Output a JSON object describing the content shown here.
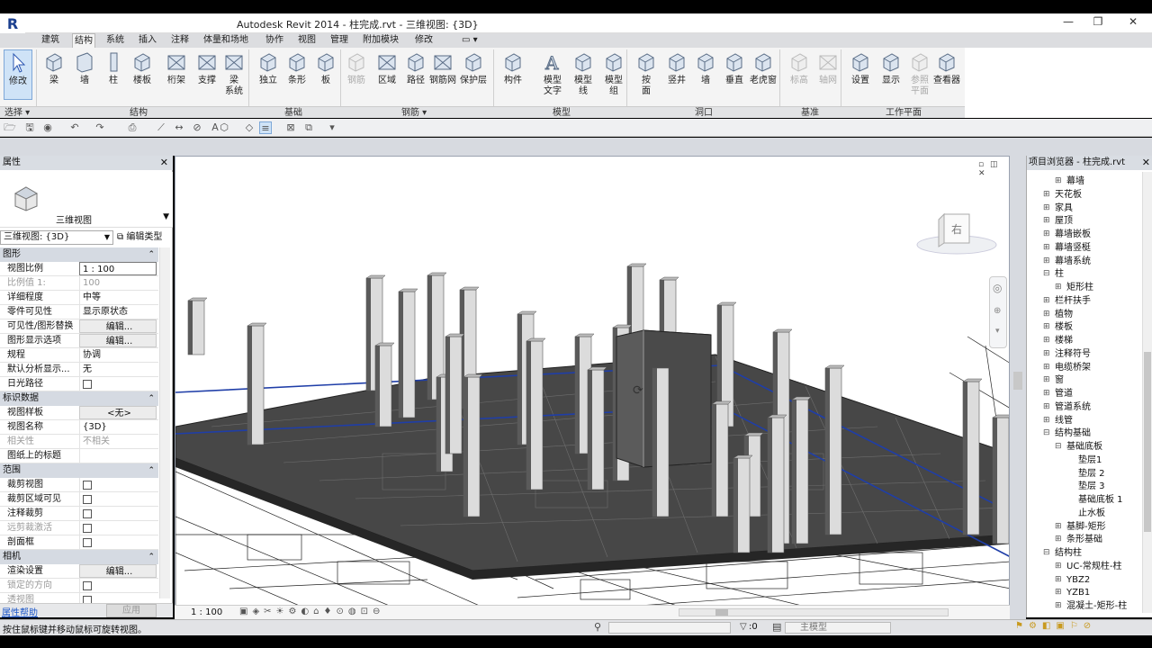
{
  "app": {
    "title": "Autodesk Revit 2014 -    柱完成.rvt - 三维视图: {3D}",
    "win_min": "—",
    "win_restore": "❐",
    "win_close": "✕",
    "logo": "R"
  },
  "tabs": [
    "建筑",
    "结构",
    "系统",
    "插入",
    "注释",
    "体量和场地",
    "协作",
    "视图",
    "管理",
    "附加模块",
    "修改"
  ],
  "active_tab": "结构",
  "ribbon": {
    "buttons": [
      {
        "label": "修改",
        "icon": "cursor-icon",
        "dim": false
      },
      {
        "label": "梁",
        "icon": "beam-icon",
        "dim": false
      },
      {
        "label": "墙",
        "icon": "wall-icon",
        "dim": false
      },
      {
        "label": "柱",
        "icon": "column-icon",
        "dim": false
      },
      {
        "label": "楼板",
        "icon": "floor-icon",
        "dim": false
      },
      {
        "label": "桁架",
        "icon": "truss-icon",
        "dim": false
      },
      {
        "label": "支撑",
        "icon": "brace-icon",
        "dim": false
      },
      {
        "label": "梁\n系统",
        "icon": "beam-system-icon",
        "dim": false
      },
      {
        "label": "独立",
        "icon": "isolated-foundation-icon",
        "dim": false
      },
      {
        "label": "条形",
        "icon": "wall-foundation-icon",
        "dim": false
      },
      {
        "label": "板",
        "icon": "slab-foundation-icon",
        "dim": false
      },
      {
        "label": "钢筋",
        "icon": "rebar-icon",
        "dim": true
      },
      {
        "label": "区域",
        "icon": "area-rebar-icon",
        "dim": false
      },
      {
        "label": "路径",
        "icon": "path-rebar-icon",
        "dim": false
      },
      {
        "label": "钢筋网",
        "icon": "fabric-icon",
        "dim": false
      },
      {
        "label": "保护层",
        "icon": "cover-icon",
        "dim": false
      },
      {
        "label": "构件",
        "icon": "component-icon",
        "dim": false
      },
      {
        "label": "模型\n文字",
        "icon": "model-text-icon",
        "dim": false
      },
      {
        "label": "模型\n线",
        "icon": "model-line-icon",
        "dim": false
      },
      {
        "label": "模型\n组",
        "icon": "model-group-icon",
        "dim": false
      },
      {
        "label": "按\n面",
        "icon": "by-face-icon",
        "dim": false
      },
      {
        "label": "竖井",
        "icon": "shaft-icon",
        "dim": false
      },
      {
        "label": "墙",
        "icon": "wall-opening-icon",
        "dim": false
      },
      {
        "label": "垂直",
        "icon": "vertical-opening-icon",
        "dim": false
      },
      {
        "label": "老虎窗",
        "icon": "dormer-icon",
        "dim": false
      },
      {
        "label": "标高",
        "icon": "level-icon",
        "dim": true
      },
      {
        "label": "轴网",
        "icon": "grid-icon",
        "dim": true
      },
      {
        "label": "设置",
        "icon": "set-icon",
        "dim": false
      },
      {
        "label": "显示",
        "icon": "show-icon",
        "dim": false
      },
      {
        "label": "参照\n平面",
        "icon": "ref-plane-icon",
        "dim": true
      },
      {
        "label": "查看器",
        "icon": "viewer-icon",
        "dim": false
      }
    ],
    "panels": [
      "选择 ▾",
      "结构",
      "基础",
      "钢筋 ▾",
      "模型",
      "洞口",
      "基准",
      "工作平面"
    ]
  },
  "properties": {
    "header": "属性",
    "type_name": "三维视图",
    "selector": "三维视图: {3D}",
    "edit_type": "编辑类型",
    "sections": [
      {
        "name": "图形",
        "rows": [
          {
            "k": "视图比例",
            "v": "1 : 100",
            "kind": "input"
          },
          {
            "k": "比例值 1:",
            "v": "100",
            "kind": "grey"
          },
          {
            "k": "详细程度",
            "v": "中等",
            "kind": "text"
          },
          {
            "k": "零件可见性",
            "v": "显示原状态",
            "kind": "text"
          },
          {
            "k": "可见性/图形替换",
            "v": "编辑...",
            "kind": "btn"
          },
          {
            "k": "图形显示选项",
            "v": "编辑...",
            "kind": "btn"
          },
          {
            "k": "规程",
            "v": "协调",
            "kind": "text"
          },
          {
            "k": "默认分析显示...",
            "v": "无",
            "kind": "text"
          },
          {
            "k": "日光路径",
            "v": "",
            "kind": "chk"
          }
        ]
      },
      {
        "name": "标识数据",
        "rows": [
          {
            "k": "视图样板",
            "v": "<无>",
            "kind": "btn"
          },
          {
            "k": "视图名称",
            "v": "{3D}",
            "kind": "text"
          },
          {
            "k": "相关性",
            "v": "不相关",
            "kind": "grey"
          },
          {
            "k": "图纸上的标题",
            "v": "",
            "kind": "text"
          }
        ]
      },
      {
        "name": "范围",
        "rows": [
          {
            "k": "裁剪视图",
            "v": "",
            "kind": "chk"
          },
          {
            "k": "裁剪区域可见",
            "v": "",
            "kind": "chk"
          },
          {
            "k": "注释裁剪",
            "v": "",
            "kind": "chk"
          },
          {
            "k": "远剪裁激活",
            "v": "",
            "kind": "greychk"
          },
          {
            "k": "剖面框",
            "v": "",
            "kind": "chk"
          }
        ]
      },
      {
        "name": "相机",
        "rows": [
          {
            "k": "渲染设置",
            "v": "编辑...",
            "kind": "btn"
          },
          {
            "k": "锁定的方向",
            "v": "",
            "kind": "greychk"
          },
          {
            "k": "透视图",
            "v": "",
            "kind": "greychk"
          }
        ]
      }
    ],
    "help_link": "属性帮助",
    "apply": "应用"
  },
  "viewport": {
    "scale": "1 : 100",
    "viewcube_face": "右"
  },
  "browser": {
    "header": "项目浏览器 - 柱完成.rvt",
    "items": [
      {
        "label": "幕墙",
        "level": 2,
        "toggle": "+"
      },
      {
        "label": "天花板",
        "level": 1,
        "toggle": "+"
      },
      {
        "label": "家具",
        "level": 1,
        "toggle": "+"
      },
      {
        "label": "屋顶",
        "level": 1,
        "toggle": "+"
      },
      {
        "label": "幕墙嵌板",
        "level": 1,
        "toggle": "+"
      },
      {
        "label": "幕墙竖梃",
        "level": 1,
        "toggle": "+"
      },
      {
        "label": "幕墙系统",
        "level": 1,
        "toggle": "+"
      },
      {
        "label": "柱",
        "level": 1,
        "toggle": "−"
      },
      {
        "label": "矩形柱",
        "level": 2,
        "toggle": "+"
      },
      {
        "label": "栏杆扶手",
        "level": 1,
        "toggle": "+"
      },
      {
        "label": "植物",
        "level": 1,
        "toggle": "+"
      },
      {
        "label": "楼板",
        "level": 1,
        "toggle": "+"
      },
      {
        "label": "楼梯",
        "level": 1,
        "toggle": "+"
      },
      {
        "label": "注释符号",
        "level": 1,
        "toggle": "+"
      },
      {
        "label": "电缆桥架",
        "level": 1,
        "toggle": "+"
      },
      {
        "label": "窗",
        "level": 1,
        "toggle": "+"
      },
      {
        "label": "管道",
        "level": 1,
        "toggle": "+"
      },
      {
        "label": "管道系统",
        "level": 1,
        "toggle": "+"
      },
      {
        "label": "线管",
        "level": 1,
        "toggle": "+"
      },
      {
        "label": "结构基础",
        "level": 1,
        "toggle": "−"
      },
      {
        "label": "基础底板",
        "level": 2,
        "toggle": "−"
      },
      {
        "label": "垫层1",
        "level": 3,
        "toggle": ""
      },
      {
        "label": "垫层 2",
        "level": 3,
        "toggle": ""
      },
      {
        "label": "垫层 3",
        "level": 3,
        "toggle": ""
      },
      {
        "label": "基础底板 1",
        "level": 3,
        "toggle": ""
      },
      {
        "label": "止水板",
        "level": 3,
        "toggle": ""
      },
      {
        "label": "基脚-矩形",
        "level": 2,
        "toggle": "+"
      },
      {
        "label": "条形基础",
        "level": 2,
        "toggle": "+"
      },
      {
        "label": "结构柱",
        "level": 1,
        "toggle": "−"
      },
      {
        "label": "UC-常规柱-柱",
        "level": 2,
        "toggle": "+"
      },
      {
        "label": "YBZ2",
        "level": 2,
        "toggle": "+"
      },
      {
        "label": "YZB1",
        "level": 2,
        "toggle": "+"
      },
      {
        "label": "混凝土-矩形-柱",
        "level": 2,
        "toggle": "+"
      }
    ]
  },
  "status": {
    "message": "按住鼠标键并移动鼠标可旋转视图。",
    "selection_count": ":0",
    "model": "主模型"
  }
}
